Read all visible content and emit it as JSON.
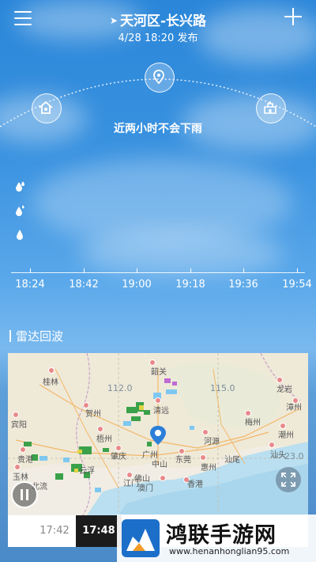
{
  "header": {
    "location": "天河区-长兴路",
    "published": "4/28 18:20 发布"
  },
  "forecast": {
    "summary": "近两小时不会下雨"
  },
  "timeline": {
    "labels": [
      "18:24",
      "18:42",
      "19:00",
      "19:18",
      "19:36",
      "19:54"
    ]
  },
  "radar": {
    "title": "雷达回波",
    "map_labels": {
      "guilin": "桂林",
      "hezhou": "贺州",
      "wuzhou": "梧州",
      "yunfu": "云浮",
      "shaoguan": "韶关",
      "qingyuan": "清远",
      "heyuan": "河源",
      "meizhou": "梅州",
      "longyan": "龙岩",
      "guangzhou": "广州",
      "foshan": "佛山",
      "dongguan": "东莞",
      "huizhou": "惠州",
      "shanwei": "汕尾",
      "zhongshan": "中山",
      "jiangmen": "江门",
      "macau": "澳门",
      "hongkong": "香港",
      "shantou": "汕头",
      "zhaoqing": "肇庆",
      "binyang": "宾阳",
      "guigang": "贵港",
      "yulin": "玉林",
      "beiliu": "北流",
      "chaozhou": "潮州",
      "zhangzhou": "漳州"
    },
    "grid": {
      "lon112": "112.0",
      "lon115": "115.0",
      "lat23": "23.0"
    },
    "time_prev": "17:42",
    "time_current": "17:48"
  },
  "watermark": {
    "title": "鸿联手游网",
    "url": "www.henanhonglian95.com"
  },
  "colors": {
    "sky_top": "#2a86d9",
    "map_bg": "#f1ede4",
    "active_time_bg": "#1b1b1b"
  }
}
